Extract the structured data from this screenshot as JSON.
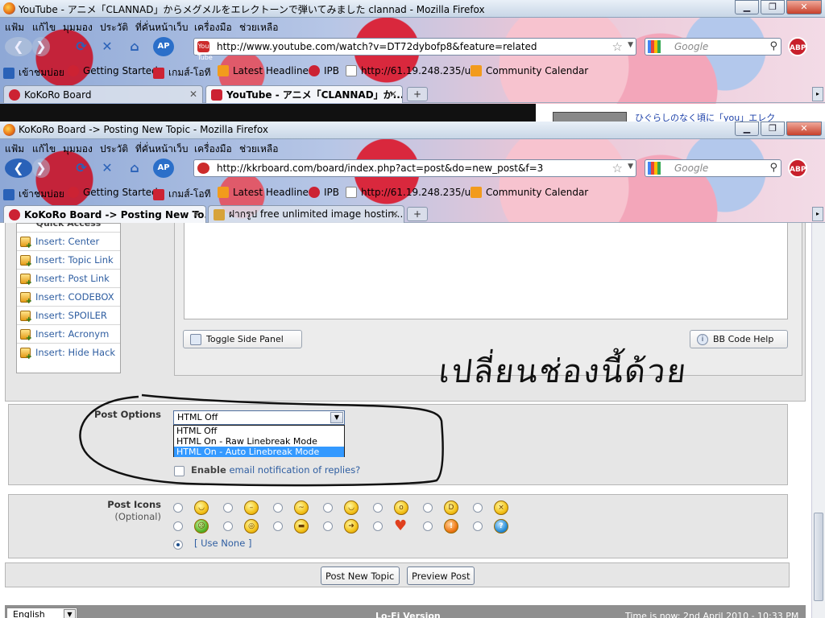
{
  "back_window": {
    "title": "YouTube - アニメ「CLANNAD」からメグメルをエレクトーンで弾いてみました clannad - Mozilla Firefox",
    "menu": [
      "แฟ้ม",
      "แก้ไข",
      "มุมมอง",
      "ประวัติ",
      "ที่คั่นหน้าเว็บ",
      "เครื่องมือ",
      "ช่วยเหลือ"
    ],
    "url": "http://www.youtube.com/watch?v=DT72dybofp8&feature=related",
    "favicon_text": "You Tube",
    "search_placeholder": "Google",
    "bookmarks": [
      "เข้าชมบ่อย",
      "Getting Started",
      "เกมส์-โอที",
      "Latest Headlines",
      "IPB",
      "http://61.19.248.235/u...",
      "Community Calendar"
    ],
    "tabs": [
      {
        "label": "KoKoRo Board"
      },
      {
        "label": "YouTube - アニメ「CLANNAD」か..."
      }
    ],
    "peek_text": "ひぐらしのなく頃に「you」エレク"
  },
  "front_window": {
    "title": "KoKoRo Board -> Posting New Topic - Mozilla Firefox",
    "menu": [
      "แฟ้ม",
      "แก้ไข",
      "มุมมอง",
      "ประวัติ",
      "ที่คั่นหน้าเว็บ",
      "เครื่องมือ",
      "ช่วยเหลือ"
    ],
    "url": "http://kkrboard.com/board/index.php?act=post&do=new_post&f=3",
    "search_placeholder": "Google",
    "abp": "ABP",
    "bookmarks": [
      "เข้าชมบ่อย",
      "Getting Started",
      "เกมส์-โอที",
      "Latest Headlines",
      "IPB",
      "http://61.19.248.235/u...",
      "Community Calendar"
    ],
    "tabs": [
      {
        "label": "KoKoRo Board -> Posting New To..."
      },
      {
        "label": "ฝากรูป free unlimited image hostin..."
      }
    ]
  },
  "quick_access": {
    "title": "Quick Access",
    "items": [
      "Insert: Center",
      "Insert: Topic Link",
      "Insert: Post Link",
      "Insert: CODEBOX",
      "Insert: SPOILER",
      "Insert: Acronym",
      "Insert: Hide Hack"
    ]
  },
  "editor": {
    "toggle_side_panel": "Toggle Side Panel",
    "bb_code_help": "BB Code Help"
  },
  "annotation_handwriting": "เปลี่ยนช่องนี้ด้วย",
  "post_options": {
    "label": "Post Options",
    "selected": "HTML Off",
    "options": [
      "HTML Off",
      "HTML On - Raw Linebreak Mode",
      "HTML On - Auto Linebreak Mode"
    ],
    "highlighted_index": 2,
    "enable_label": "Enable",
    "enable_rest": "email notification of replies?"
  },
  "post_icons": {
    "label": "Post Icons",
    "sublabel": "(Optional)",
    "use_none": "[ Use None ]"
  },
  "actions": {
    "post_new_topic": "Post New Topic",
    "preview_post": "Preview Post"
  },
  "footer": {
    "language": "English",
    "lofi": "Lo-Fi Version",
    "time": "Time is now: 2nd April 2010 - 10:33 PM"
  }
}
